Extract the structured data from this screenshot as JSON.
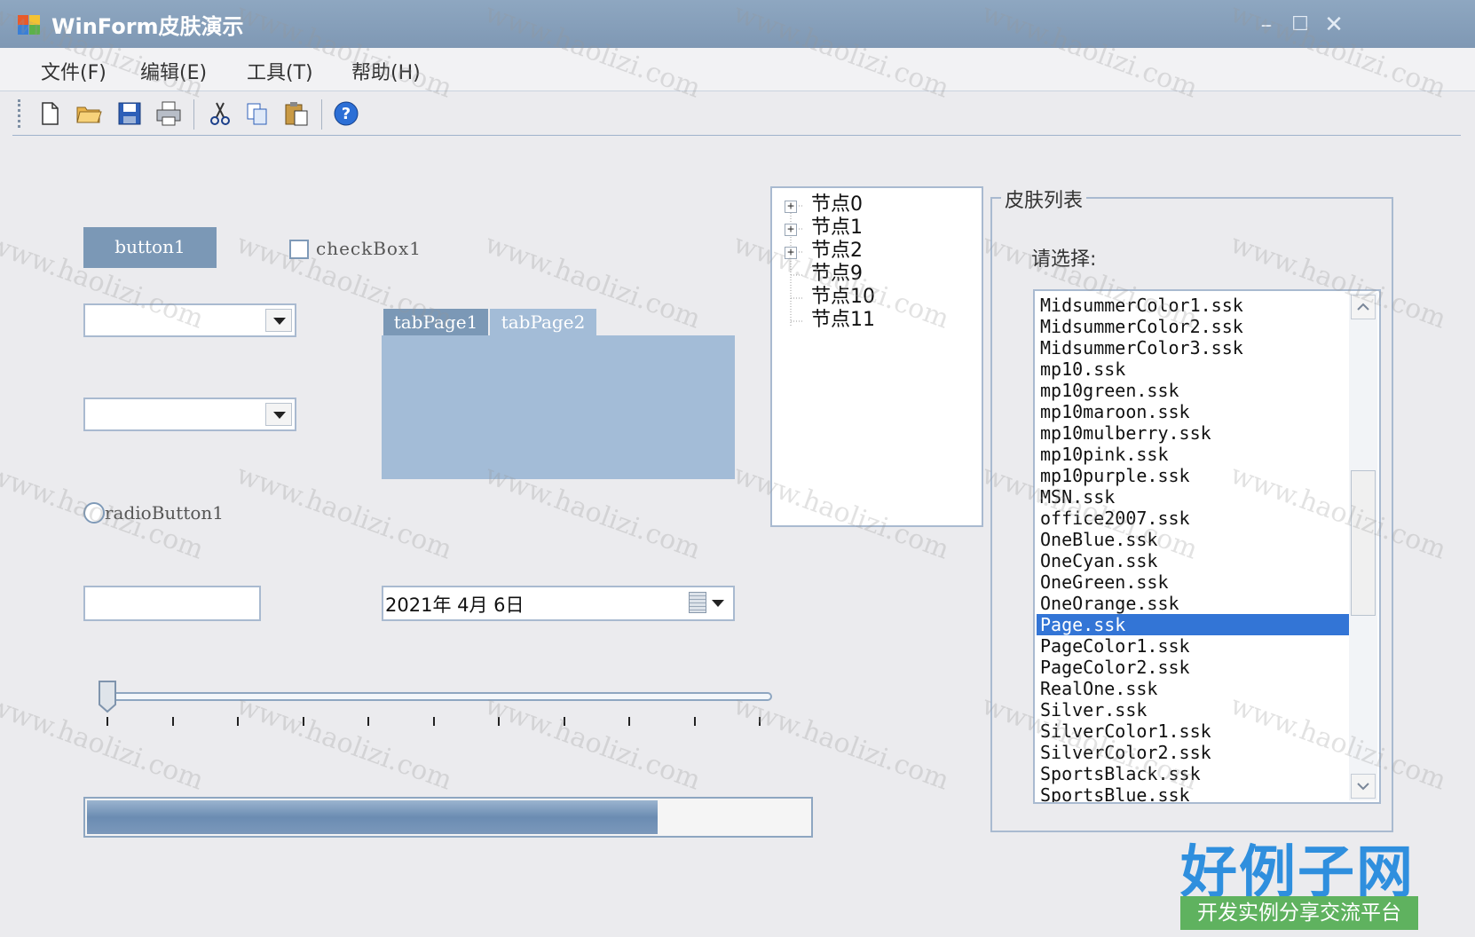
{
  "window": {
    "title": "WinForm皮肤演示"
  },
  "menu": [
    "文件(F)",
    "编辑(E)",
    "工具(T)",
    "帮助(H)"
  ],
  "toolbar": {
    "icons": [
      "new-file-icon",
      "open-folder-icon",
      "save-icon",
      "print-icon",
      "cut-icon",
      "copy-icon",
      "paste-icon",
      "help-icon"
    ]
  },
  "controls": {
    "button1": "button1",
    "checkbox1": "checkBox1",
    "tabs": [
      "tabPage1",
      "tabPage2"
    ],
    "radio1": "radioButton1",
    "textbox_value": "",
    "date": "2021年  4月  6日",
    "trackbar_value_fraction": 0.0,
    "trackbar_ticks": 11,
    "progress_fraction": 0.79
  },
  "tree": [
    "节点0",
    "节点1",
    "节点2",
    "节点9",
    "节点10",
    "节点11"
  ],
  "skin_group": {
    "title": "皮肤列表",
    "prompt": "请选择:",
    "items": [
      "MidsummerColor1.ssk",
      "MidsummerColor2.ssk",
      "MidsummerColor3.ssk",
      "mp10.ssk",
      "mp10green.ssk",
      "mp10maroon.ssk",
      "mp10mulberry.ssk",
      "mp10pink.ssk",
      "mp10purple.ssk",
      "MSN.ssk",
      "office2007.ssk",
      "OneBlue.ssk",
      "OneCyan.ssk",
      "OneGreen.ssk",
      "OneOrange.ssk",
      "Page.ssk",
      "PageColor1.ssk",
      "PageColor2.ssk",
      "RealOne.ssk",
      "Silver.ssk",
      "SilverColor1.ssk",
      "SilverColor2.ssk",
      "SportsBlack.ssk",
      "SportsBlue.ssk"
    ],
    "selected_index": 15
  },
  "watermark": "www.haolizi.com",
  "logo": {
    "main": "好例子网",
    "sub": "开发实例分享交流平台"
  },
  "colors": {
    "title_bar": "#7f98b4",
    "accent": "#7b98b6",
    "selection": "#3375d6"
  }
}
